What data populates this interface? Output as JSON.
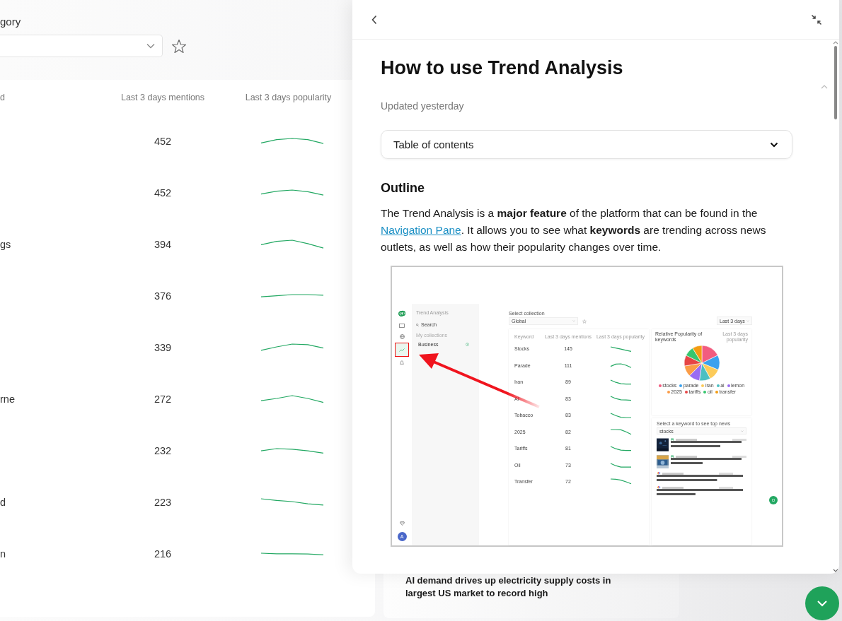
{
  "category": {
    "label": "gory"
  },
  "keywords_table": {
    "columns": [
      "d",
      "Last 3 days mentions",
      "Last 3 days popularity"
    ],
    "rows": [
      {
        "mentions": "452"
      },
      {
        "mentions": "452"
      },
      {
        "keyword": "gs",
        "mentions": "394"
      },
      {
        "mentions": "376"
      },
      {
        "mentions": "339"
      },
      {
        "keyword": "rne",
        "mentions": "272"
      },
      {
        "mentions": "232"
      },
      {
        "keyword": "d",
        "mentions": "223"
      },
      {
        "keyword": "n",
        "mentions": "216"
      }
    ]
  },
  "news_card": {
    "title": "AI demand drives up electricity supply costs in largest US market to record high"
  },
  "article": {
    "title": "How to use Trend Analysis",
    "updated": "Updated yesterday",
    "toc": {
      "label": "Table of contents",
      "expanded": false
    },
    "heading": "Outline",
    "paragraph": [
      {
        "text": "The Trend Analysis is a **major feature** of the platform that can be found in the "
      },
      {
        "link": "Navigation Pane"
      },
      {
        "text": ". It allows you to see what **keywords** are trending across news outlets, as well as how their popularity changes over time."
      }
    ],
    "screenshot": {
      "panel": {
        "title": "Trend Analysis",
        "search": "Search",
        "section": "My collections",
        "collections": [
          {
            "name": "Business"
          }
        ]
      },
      "avatar": "A",
      "collection": {
        "label": "Select collection",
        "value": "Global"
      },
      "period": "Last 3 days",
      "table": {
        "columns": [
          "Keyword",
          "Last 3 days mentions",
          "Last 3 days popularity"
        ],
        "rows": [
          {
            "keyword": "Stocks",
            "mentions": "145"
          },
          {
            "keyword": "Parade",
            "mentions": "111"
          },
          {
            "keyword": "Iran",
            "mentions": "89"
          },
          {
            "keyword": "AI",
            "mentions": "83"
          },
          {
            "keyword": "Tobacco",
            "mentions": "83"
          },
          {
            "keyword": "2025",
            "mentions": "82"
          },
          {
            "keyword": "Tariffs",
            "mentions": "81"
          },
          {
            "keyword": "Oil",
            "mentions": "73"
          },
          {
            "keyword": "Transfer",
            "mentions": "72"
          }
        ]
      },
      "pie": {
        "title": "Relative Popularity of keywords",
        "subtitle": "Last 3 days popularity",
        "legend": [
          {
            "label": "stocks",
            "color": "#f25c7f"
          },
          {
            "label": "parade",
            "color": "#3aa1ee"
          },
          {
            "label": "iran",
            "color": "#fccb5a"
          },
          {
            "label": "ai",
            "color": "#4bbfc2"
          },
          {
            "label": "lemon",
            "color": "#9a6cf3"
          },
          {
            "label": "2025",
            "color": "#fb9d48"
          },
          {
            "label": "tariffs",
            "color": "#e64545"
          },
          {
            "label": "oil",
            "color": "#36c66e"
          },
          {
            "label": "transfer",
            "color": "#f39c12"
          }
        ]
      },
      "news": {
        "label": "Select a keyword to see top news",
        "value": "stocks",
        "items": [
          {
            "kind": "marketwatch",
            "thumbnail": true
          },
          {
            "kind": "marketwatch",
            "thumbnail": true
          },
          {
            "kind": "cnbc",
            "thumbnail": false
          },
          {
            "kind": "cnbc",
            "thumbnail": false
          }
        ]
      }
    }
  }
}
